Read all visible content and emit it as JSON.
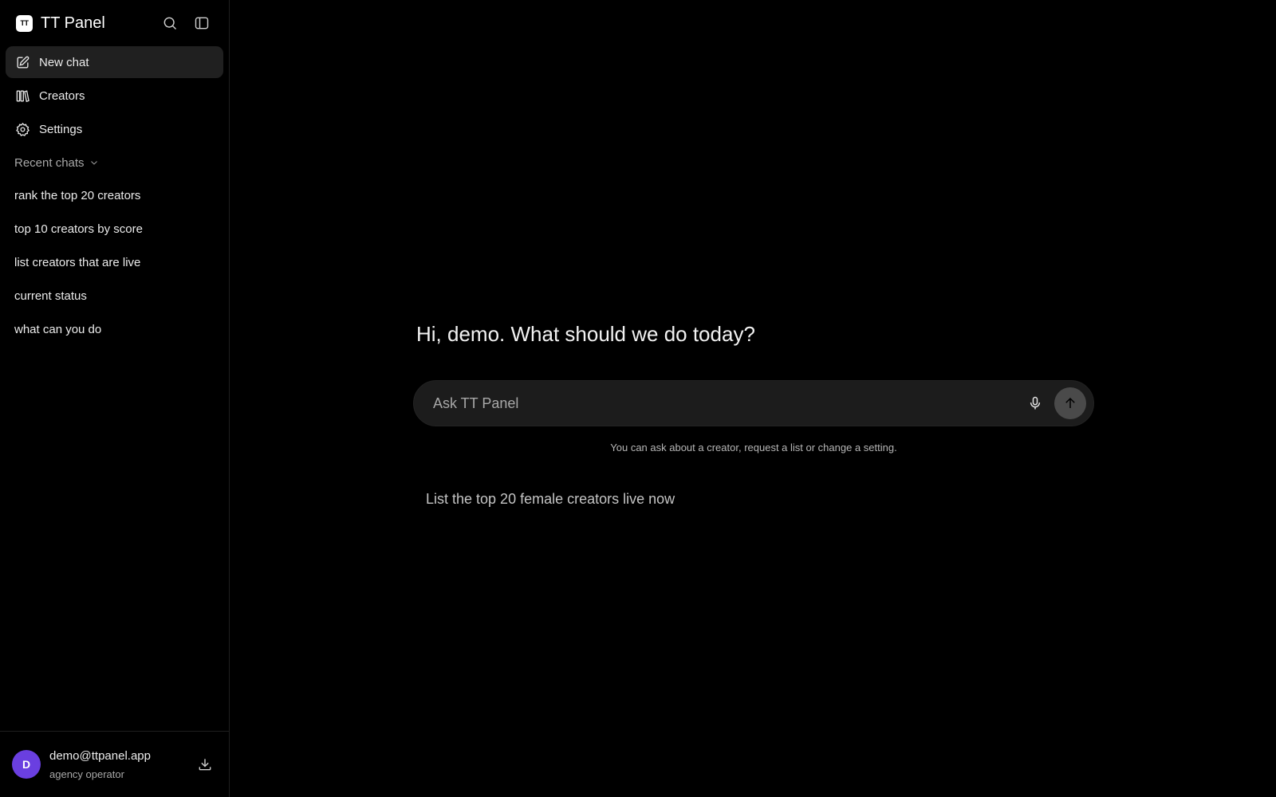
{
  "sidebar": {
    "brand": {
      "logo_text": "TT",
      "name": "TT Panel"
    },
    "header_icons": [
      "search-icon",
      "sidebar-toggle-icon"
    ],
    "nav": [
      {
        "label": "New chat",
        "icon": "edit-icon",
        "active": true
      },
      {
        "label": "Creators",
        "icon": "library-icon",
        "active": false
      },
      {
        "label": "Settings",
        "icon": "gear-icon",
        "active": false
      }
    ],
    "recent_label": "Recent chats",
    "recent": [
      "rank the top 20 creators",
      "top 10 creators by score",
      "list creators that are live",
      "current status",
      "what can you do"
    ],
    "user": {
      "avatar_initial": "D",
      "avatar_color": "#6a3fe0",
      "email": "demo@ttpanel.app",
      "role": "agency operator"
    }
  },
  "main": {
    "greeting": "Hi, demo. What should we do today?",
    "composer": {
      "placeholder": "Ask TT Panel",
      "value": ""
    },
    "hint": "You can ask about a creator, request a list or change a setting.",
    "suggestion": "List the top 20 female creators live now"
  },
  "colors": {
    "background": "#000000",
    "active_nav": "#202020",
    "composer_bg": "#1c1c1c",
    "send_button": "#4a4a4a"
  }
}
